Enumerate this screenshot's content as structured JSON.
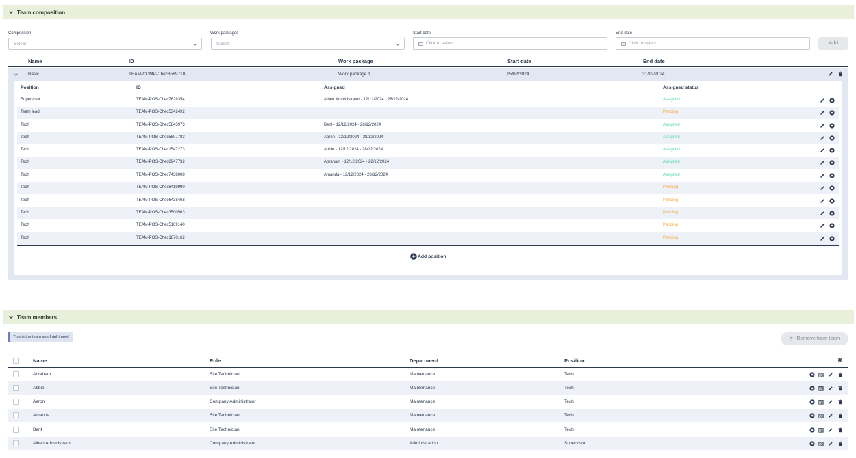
{
  "composition_section": {
    "title": "Team composition",
    "filters": [
      {
        "label": "Composition",
        "placeholder": "Select"
      },
      {
        "label": "Work packages",
        "placeholder": "Select"
      },
      {
        "label": "Start date",
        "placeholder": "Click to select"
      },
      {
        "label": "End date",
        "placeholder": "Click to select"
      }
    ],
    "add_label": "Add",
    "columns": {
      "name": "Name",
      "id": "ID",
      "work_package": "Work package",
      "start_date": "Start date",
      "end_date": "End date"
    },
    "composition": {
      "name": "Basic",
      "id": "TEAM-COMP-Chec8589710",
      "work_package": "Work package 1",
      "start_date": "15/02/2024",
      "end_date": "31/12/2024"
    },
    "position_columns": {
      "position": "Position",
      "id": "ID",
      "assigned": "Assigned",
      "assigned_status": "Assigned status"
    },
    "positions": [
      {
        "position": "Supervisor",
        "id": "TEAM-POS-Chec7629354",
        "assigned": "Albert Administrator - 12/12/2024 - 28/12/2024",
        "status": "Assigned"
      },
      {
        "position": "Team lead",
        "id": "TEAM-POS-Chec5342492",
        "assigned": "",
        "status": "Pending"
      },
      {
        "position": "Tech",
        "id": "TEAM-POS-Chec5843973",
        "assigned": "Berit - 12/12/2024 - 28/12/2024",
        "status": "Assigned"
      },
      {
        "position": "Tech",
        "id": "TEAM-POS-Chec5807783",
        "assigned": "Aaron - 12/12/2024 - 28/12/2024",
        "status": "Assigned"
      },
      {
        "position": "Tech",
        "id": "TEAM-POS-Chec1547273",
        "assigned": "Abbie - 12/12/2024 - 28/12/2024",
        "status": "Assigned"
      },
      {
        "position": "Tech",
        "id": "TEAM-POS-Chec8947732",
        "assigned": "Abraham - 12/12/2024 - 28/12/2024",
        "status": "Assigned"
      },
      {
        "position": "Tech",
        "id": "TEAM-POS-Chec7438008",
        "assigned": "Amanda - 12/12/2024 - 28/12/2024",
        "status": "Assigned"
      },
      {
        "position": "Tech",
        "id": "TEAM-POS-Chec8419990",
        "assigned": "",
        "status": "Pending"
      },
      {
        "position": "Tech",
        "id": "TEAM-POS-Chec6438468",
        "assigned": "",
        "status": "Pending"
      },
      {
        "position": "Tech",
        "id": "TEAM-POS-Chec3500563",
        "assigned": "",
        "status": "Pending"
      },
      {
        "position": "Tech",
        "id": "TEAM-POS-Chec5169140",
        "assigned": "",
        "status": "Pending"
      },
      {
        "position": "Tech",
        "id": "TEAM-POS-Chec1870162",
        "assigned": "",
        "status": "Pending"
      }
    ],
    "add_position_label": "Add position"
  },
  "members_section": {
    "title": "Team members",
    "banner": "This is the team as of right now!",
    "remove_label": "Remove from team",
    "columns": {
      "name": "Name",
      "role": "Role",
      "department": "Department",
      "position": "Position"
    },
    "members": [
      {
        "name": "Abraham",
        "role": "Site Technician",
        "department": "Maintenance",
        "position": "Tech"
      },
      {
        "name": "Abbie",
        "role": "Site Technician",
        "department": "Maintenance",
        "position": "Tech"
      },
      {
        "name": "Aaron",
        "role": "Company Administrator",
        "department": "Maintenance",
        "position": "Tech"
      },
      {
        "name": "Amanda",
        "role": "Site Technician",
        "department": "Maintenance",
        "position": "Tech"
      },
      {
        "name": "Berit",
        "role": "Site Technician",
        "department": "Maintenance",
        "position": "Tech"
      },
      {
        "name": "Albert Administrator",
        "role": "Company Administrator",
        "department": "Administration",
        "position": "Supervisor"
      }
    ]
  },
  "colors": {
    "accent_green_bg": "#e8f0db",
    "assigned": "#4fd3a5",
    "pending": "#f2a93b",
    "text": "#2d3a4d"
  }
}
